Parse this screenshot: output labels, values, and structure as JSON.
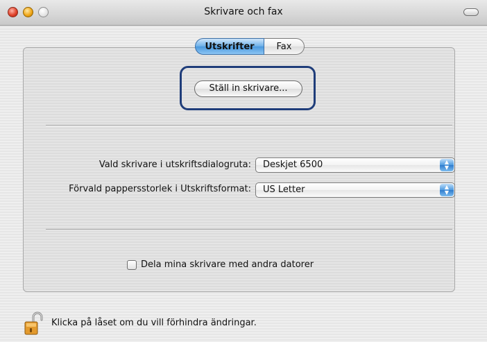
{
  "window": {
    "title": "Skrivare och fax"
  },
  "tabs": [
    {
      "label": "Utskrifter",
      "active": true
    },
    {
      "label": "Fax",
      "active": false
    }
  ],
  "setup_button": {
    "label": "Ställ in skrivare..."
  },
  "default_printer": {
    "label": "Vald skrivare i utskriftsdialogruta:",
    "value": "Deskjet 6500"
  },
  "default_paper": {
    "label": "Förvald pappersstorlek i Utskriftsformat:",
    "value": "US Letter"
  },
  "share_printers": {
    "label": "Dela mina skrivare med andra datorer",
    "checked": false
  },
  "lock": {
    "text": "Klicka på låset om du vill förhindra ändringar.",
    "icon": "unlocked-padlock-icon"
  },
  "colors": {
    "focus_ring": "#1f3d7a",
    "accent_blue": "#4a98dd"
  }
}
